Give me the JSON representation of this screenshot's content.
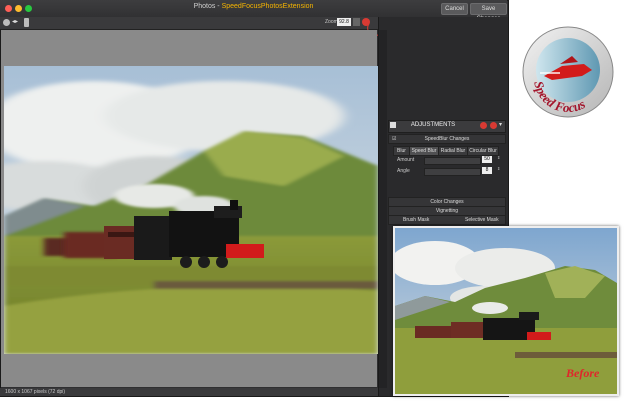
{
  "window": {
    "title_prefix": "Photos - ",
    "title_accent": "SpeedFocusPhotosExtension",
    "cancel_label": "Cancel",
    "save_label": "Save Changes"
  },
  "toolbar": {
    "zoom_label": "Zoom",
    "zoom_value": "92.8"
  },
  "status": {
    "text": "1600 x 1067 pixels (72 dpi)"
  },
  "panel": {
    "adjustments_title": "ADJUSTMENTS",
    "speedblur_section": "SpeedBlur Changes",
    "tabs": [
      "Blur",
      "Speed Blur",
      "Radial Blur",
      "Circular Blur"
    ],
    "amount_label": "Amount",
    "amount_value": "50",
    "angle_label": "Angle",
    "angle_value": "8",
    "color_changes": "Color Changes",
    "vignetting": "Vignetting",
    "brush_mask": "Brush Mask",
    "selective_mask": "Selective Mask"
  },
  "before_label": "Before",
  "logo": {
    "text": "Speed Focus"
  },
  "colors": {
    "accent": "#f5b400",
    "red": "#d93a33",
    "before_red": "#e0262b"
  }
}
